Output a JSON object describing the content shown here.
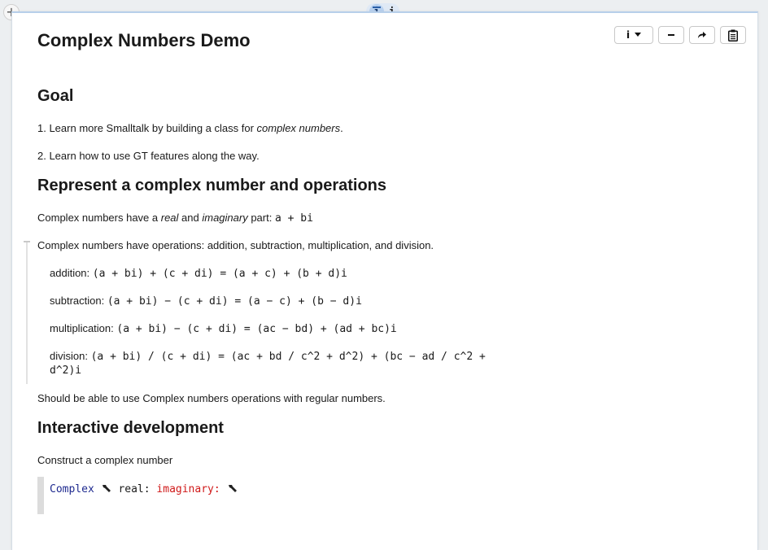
{
  "chrome": {
    "add_icon": "plus-icon",
    "tab_label": "i"
  },
  "toolbar": {
    "info_label": "i",
    "minimize_label": "–",
    "share_icon": "share-arrow-icon",
    "clipboard_icon": "clipboard-icon"
  },
  "page": {
    "title": "Complex Numbers Demo",
    "goal": {
      "heading": "Goal",
      "item1_prefix": "1. Learn more Smalltalk by building a class for ",
      "item1_em": "complex numbers",
      "item1_suffix": ".",
      "item2": "2. Learn how to use GT features along the way."
    },
    "represent": {
      "heading": "Represent a complex number and operations",
      "intro_a": "Complex numbers have a ",
      "intro_real": "real",
      "intro_and": " and ",
      "intro_imag": "imaginary",
      "intro_part": " part: ",
      "intro_expr": "a + bi",
      "ops_intro": "Complex numbers have operations:  addition, subtraction, multiplication, and division.",
      "ops": [
        {
          "label": "addition:",
          "formula": "(a + bi) + (c + di) = (a + c) + (b + d)i"
        },
        {
          "label": "subtraction:",
          "formula": " (a + bi) − (c + di) = (a − c) + (b − d)i"
        },
        {
          "label": "multiplication:",
          "formula": " (a + bi) − (c + di) = (ac − bd) + (ad + bc)i"
        },
        {
          "label": "division:",
          "formula": "(a + bi) / (c + di) = (ac + bd / c^2 + d^2) + (bc − ad / c^2 +",
          "formula_wrap": "d^2)i"
        }
      ],
      "regular": "Should be able to use Complex numbers operations with regular numbers."
    },
    "interactive": {
      "heading": "Interactive development",
      "construct": "Construct a complex number",
      "code": {
        "class_name": "Complex",
        "real_kw": "real:",
        "imag_kw": "imaginary:",
        "placeholder_icon": "wrench-icon"
      }
    }
  }
}
